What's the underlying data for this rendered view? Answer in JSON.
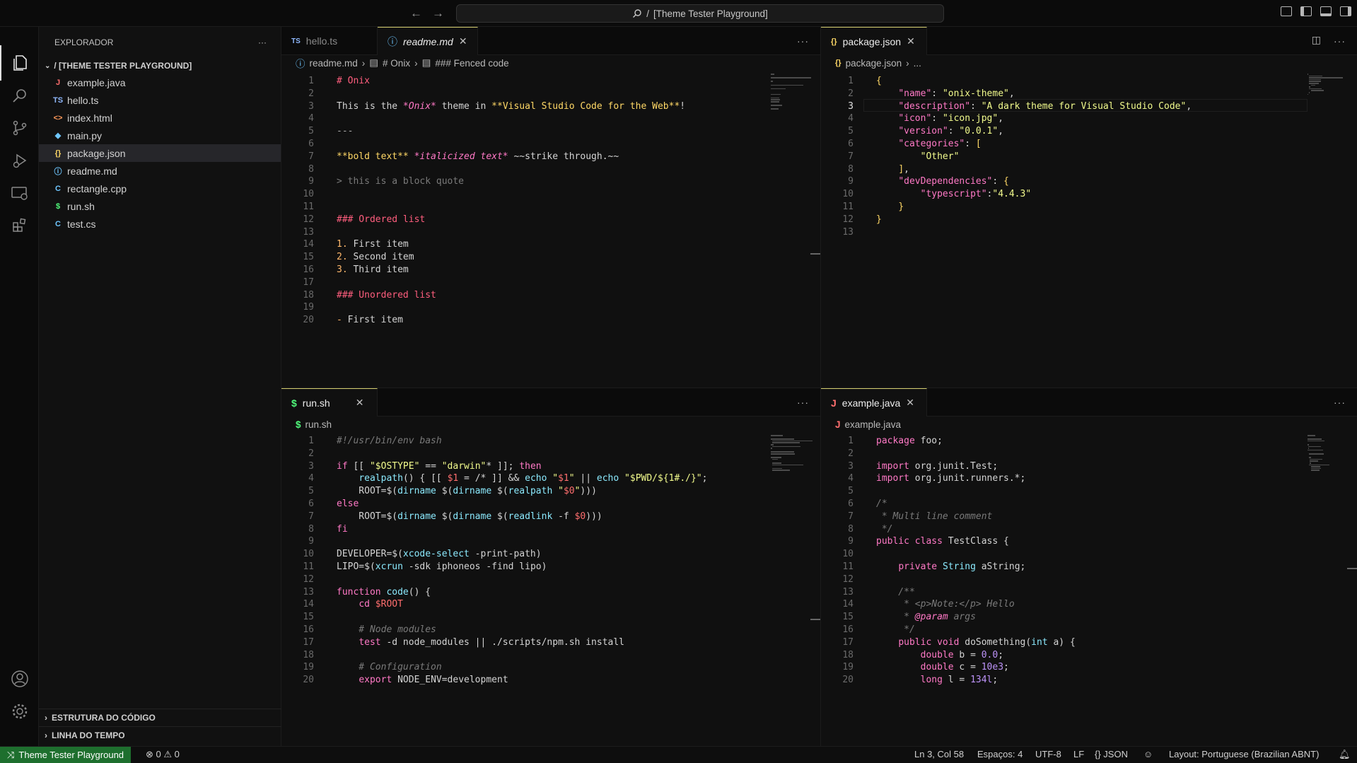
{
  "titlebar": {
    "search_text": "[Theme Tester Playground]",
    "back_icon": "arrow-left-icon",
    "forward_icon": "arrow-right-icon"
  },
  "activity_bar": [
    "explorer-icon",
    "search-icon",
    "source-control-icon",
    "run-debug-icon",
    "remote-explorer-icon",
    "extensions-icon",
    "account-icon",
    "manage-gear-icon"
  ],
  "sidebar": {
    "title": "EXPLORADOR",
    "more": "···",
    "root": "/ [THEME TESTER PLAYGROUND]",
    "files": [
      {
        "icon": "J",
        "name": "example.java",
        "color": "#ff6e6e"
      },
      {
        "icon": "TS",
        "name": "hello.ts",
        "color": "#8fb8ff"
      },
      {
        "icon": "<>",
        "name": "index.html",
        "color": "#ff9a5a"
      },
      {
        "icon": "◆",
        "name": "main.py",
        "color": "#6ec6ff"
      },
      {
        "icon": "{}",
        "name": "package.json",
        "color": "#ffd866"
      },
      {
        "icon": "ⓘ",
        "name": "readme.md",
        "color": "#6ec6ff"
      },
      {
        "icon": "C",
        "name": "rectangle.cpp",
        "color": "#6ec6ff"
      },
      {
        "icon": "$",
        "name": "run.sh",
        "color": "#50fa7b"
      },
      {
        "icon": "C",
        "name": "test.cs",
        "color": "#6ec6ff"
      }
    ],
    "outline": "ESTRUTURA DO CÓDIGO",
    "timeline": "LINHA DO TEMPO"
  },
  "pane_top_left": {
    "tabs": [
      {
        "label": "hello.ts",
        "icon": "TS"
      },
      {
        "label": "readme.md",
        "icon": "ⓘ"
      }
    ],
    "breadcrumb": [
      "readme.md",
      "# Onix",
      "### Fenced code"
    ]
  },
  "pane_top_right": {
    "tabs": [
      {
        "label": "package.json",
        "icon": "{}"
      }
    ],
    "breadcrumb": [
      "package.json",
      "..."
    ]
  },
  "pane_bottom_left": {
    "tabs": [
      {
        "label": "run.sh",
        "icon": "$"
      }
    ],
    "breadcrumb": [
      "run.sh"
    ]
  },
  "pane_bottom_right": {
    "tabs": [
      {
        "label": "example.java",
        "icon": "J"
      }
    ],
    "breadcrumb": [
      "example.java"
    ]
  },
  "statusbar": {
    "remote": "Theme Tester Playground",
    "problems": "⊗ 0 ⚠ 0",
    "position": "Ln 3, Col 58",
    "spaces": "Espaços: 4",
    "encoding": "UTF-8",
    "eol": "LF",
    "language": "{} JSON",
    "layout": "Layout: Portuguese (Brazilian ABNT)"
  },
  "code_readme": [
    "# Onix",
    "",
    "This is the *Onix* theme in **Visual Studio Code for the Web**!",
    "",
    "---",
    "",
    "**bold text** *italicized text* ~~strike through.~~",
    "",
    "> this is a block quote",
    "",
    "",
    "### Ordered list",
    "",
    "1. First item",
    "2. Second item",
    "3. Third item",
    "",
    "### Unordered list",
    "",
    "- First item"
  ],
  "code_package": [
    "{",
    "    \"name\": \"onix-theme\",",
    "    \"description\": \"A dark theme for Visual Studio Code\",",
    "    \"icon\": \"icon.jpg\",",
    "    \"version\": \"0.0.1\",",
    "    \"categories\": [",
    "        \"Other\"",
    "    ],",
    "    \"devDependencies\": {",
    "        \"typescript\":\"4.4.3\"",
    "    }",
    "}",
    ""
  ],
  "code_run": [
    "#!/usr/bin/env bash",
    "",
    "if [[ \"$OSTYPE\" == \"darwin\"* ]]; then",
    "    realpath() { [[ $1 = /* ]] && echo \"$1\" || echo \"$PWD/${1#./}\";",
    "    ROOT=$(dirname $(dirname $(realpath \"$0\")))",
    "else",
    "    ROOT=$(dirname $(dirname $(readlink -f $0)))",
    "fi",
    "",
    "DEVELOPER=$(xcode-select -print-path)",
    "LIPO=$(xcrun -sdk iphoneos -find lipo)",
    "",
    "function code() {",
    "    cd $ROOT",
    "",
    "    # Node modules",
    "    test -d node_modules || ./scripts/npm.sh install",
    "",
    "    # Configuration",
    "    export NODE_ENV=development"
  ],
  "code_java": [
    "package foo;",
    "",
    "import org.junit.Test;",
    "import org.junit.runners.*;",
    "",
    "/*",
    " * Multi line comment",
    " */",
    "public class TestClass {",
    "",
    "    private String aString;",
    "",
    "    /**",
    "     * <p>Note:</p> Hello",
    "     * @param args",
    "     */",
    "    public void doSomething(int a) {",
    "        double b = 0.0;",
    "        double c = 10e3;",
    "        long l = 134l;"
  ]
}
